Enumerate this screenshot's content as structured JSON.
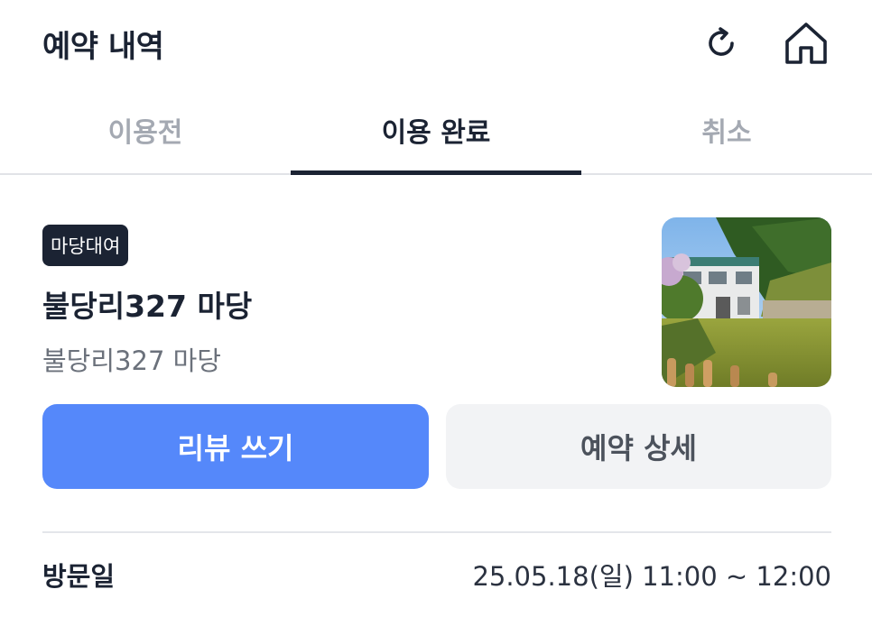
{
  "header": {
    "title": "예약 내역",
    "refresh_icon": "refresh-icon",
    "home_icon": "home-icon"
  },
  "tabs": [
    {
      "label": "이용전",
      "active": false
    },
    {
      "label": "이용 완료",
      "active": true
    },
    {
      "label": "취소",
      "active": false
    }
  ],
  "reservation": {
    "badge": "마당대여",
    "venue_name": "불당리327 마당",
    "venue_subtitle": "불당리327 마당",
    "thumbnail": "venue-photo"
  },
  "actions": {
    "review_label": "리뷰 쓰기",
    "detail_label": "예약 상세"
  },
  "visit": {
    "label": "방문일",
    "value": "25.05.18(일) 11:00 ~ 12:00"
  },
  "colors": {
    "primary": "#5588fa",
    "text_dark": "#1b2333",
    "tab_inactive": "#a4a9b2",
    "secondary_button": "#f2f3f5"
  }
}
